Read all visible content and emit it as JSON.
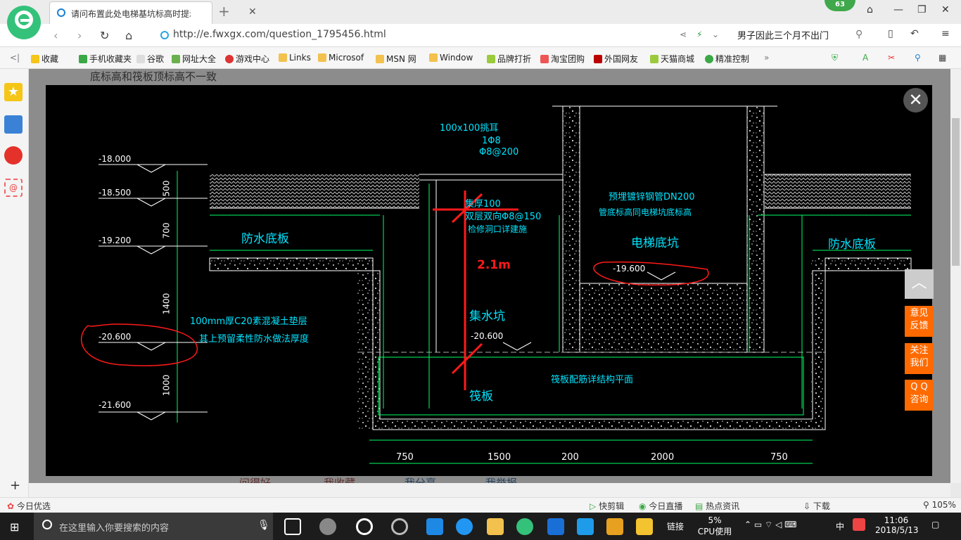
{
  "browser": {
    "tab_title": "请问布置此处电梯基坑标高时提示",
    "tab_close": "✕",
    "new_tab": "+",
    "badge": "63",
    "url": "http://e.fwxgx.com/question_1795456.html",
    "search_text": "男子因此三个月不出门",
    "window_controls": [
      "⌂",
      "—",
      "❐",
      "✕"
    ]
  },
  "bookmarks": [
    "收藏",
    "手机收藏夹",
    "谷歌",
    "网址大全",
    "游戏中心",
    "Links",
    "Microsof",
    "MSN 网",
    "Window",
    "品牌打折",
    "淘宝团购",
    "外国网友",
    "天猫商城",
    "精准控制"
  ],
  "page": {
    "title_text": "底标高和筏板顶标高不一致",
    "close": "✕",
    "feedback_buttons": [
      "意见\n反馈",
      "关注\n我们",
      "Q Q\n咨询"
    ],
    "bottom_links": [
      "问得好",
      "我收藏",
      "我分享",
      "我举报"
    ]
  },
  "drawing": {
    "elev": [
      "-18.000",
      "-18.500",
      "-19.200",
      "-20.600",
      "-21.600"
    ],
    "dims_vertical": [
      "500",
      "700",
      "1400",
      "1000"
    ],
    "dims_bottom": [
      "750",
      "1500",
      "200",
      "2000",
      "750"
    ],
    "labels": {
      "lug": "100x100挑耳",
      "lug_r1": "1Φ8",
      "lug_r2": "Φ8@200",
      "cover": "集厚100",
      "cover2": "双层双向Φ8@150",
      "cover3": "检修洞口详建施",
      "pipe1": "预埋镀锌钢管DN200",
      "pipe2": "管底标高同电梯坑底标高",
      "waterproof_l": "防水底板",
      "waterproof_r": "防水底板",
      "pit": "电梯底坑",
      "pit_elev": "-19.600",
      "sump": "集水坑",
      "sump_elev": "-20.600",
      "raft": "筏板",
      "raft_note": "筏板配筋详结构平面",
      "pad1": "100mm厚C20素混凝土垫层",
      "pad2": "其上预留柔性防水做法厚度",
      "annot": "2.1m"
    }
  },
  "statusbar": {
    "left": "今日优选",
    "items": [
      "快剪辑",
      "今日直播",
      "热点资讯",
      "下载"
    ],
    "zoom": "105%"
  },
  "taskbar": {
    "search_placeholder": "在这里输入你要搜索的内容",
    "links": "链接",
    "cpu_pct": "5%",
    "cpu_label": "CPU使用",
    "ime": "中",
    "time": "11:06",
    "date": "2018/5/13"
  },
  "colors": {
    "cad_line": "#00ff66",
    "cad_text": "#00e5ff",
    "annot": "#ff1a1a",
    "dim": "#ffffff"
  }
}
